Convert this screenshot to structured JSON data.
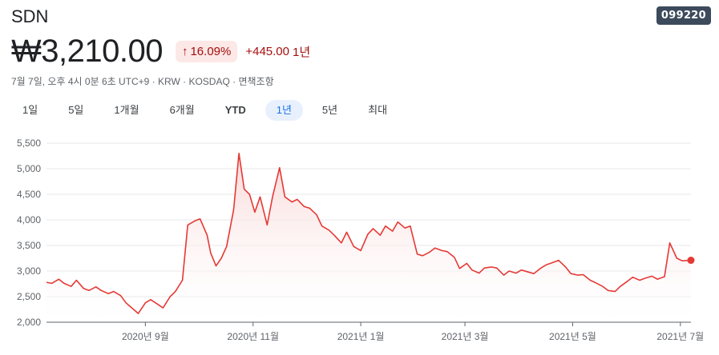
{
  "header": {
    "name": "SDN",
    "code": "099220",
    "price": "₩3,210.00",
    "change_pct": "16.09%",
    "change_arrow": "↑",
    "change_abs": "+445.00",
    "change_period": "1년",
    "meta": "7월 7일, 오후 4시 0분 6초 UTC+9 · KRW · KOSDAQ · 면책조항"
  },
  "tabs": [
    {
      "label": "1일"
    },
    {
      "label": "5일"
    },
    {
      "label": "1개월"
    },
    {
      "label": "6개월"
    },
    {
      "label": "YTD"
    },
    {
      "label": "1년",
      "active": true
    },
    {
      "label": "5년"
    },
    {
      "label": "최대"
    }
  ],
  "colors": {
    "line": "#e53935",
    "fill_top": "#f8d7d5",
    "grid": "#e8eaed",
    "badge_bg": "#fce8e6",
    "badge_text": "#a50e0e"
  },
  "chart_data": {
    "type": "area",
    "title": "",
    "xlabel": "",
    "ylabel": "",
    "ylim": [
      2000,
      5500
    ],
    "yticks": [
      "5,500",
      "5,000",
      "4,500",
      "4,000",
      "3,500",
      "3,000",
      "2,500",
      "2,000"
    ],
    "ytick_values": [
      5500,
      5000,
      4500,
      4000,
      3500,
      3000,
      2500,
      2000
    ],
    "xticks": [
      "2020년 9월",
      "2020년 11월",
      "2021년 1월",
      "2021년 3월",
      "2021년 5월",
      "2021년 7월"
    ],
    "xtick_dates": [
      "2020-09-01",
      "2020-11-01",
      "2021-01-01",
      "2021-03-01",
      "2021-05-01",
      "2021-07-01"
    ],
    "grid": true,
    "series": [
      {
        "dates": [
          "2020-07-07",
          "2020-07-10",
          "2020-07-14",
          "2020-07-17",
          "2020-07-21",
          "2020-07-24",
          "2020-07-28",
          "2020-07-31",
          "2020-08-04",
          "2020-08-07",
          "2020-08-11",
          "2020-08-14",
          "2020-08-18",
          "2020-08-21",
          "2020-08-25",
          "2020-08-28",
          "2020-09-01",
          "2020-09-04",
          "2020-09-08",
          "2020-09-11",
          "2020-09-15",
          "2020-09-18",
          "2020-09-22",
          "2020-09-25",
          "2020-09-29",
          "2020-10-02",
          "2020-10-06",
          "2020-10-08",
          "2020-10-11",
          "2020-10-14",
          "2020-10-17",
          "2020-10-21",
          "2020-10-24",
          "2020-10-27",
          "2020-10-30",
          "2020-11-02",
          "2020-11-05",
          "2020-11-09",
          "2020-11-12",
          "2020-11-16",
          "2020-11-19",
          "2020-11-23",
          "2020-11-26",
          "2020-11-30",
          "2020-12-03",
          "2020-12-07",
          "2020-12-10",
          "2020-12-14",
          "2020-12-17",
          "2020-12-21",
          "2020-12-24",
          "2020-12-28",
          "2021-01-01",
          "2021-01-05",
          "2021-01-08",
          "2021-01-12",
          "2021-01-15",
          "2021-01-19",
          "2021-01-22",
          "2021-01-26",
          "2021-01-29",
          "2021-02-02",
          "2021-02-05",
          "2021-02-09",
          "2021-02-12",
          "2021-02-16",
          "2021-02-19",
          "2021-02-23",
          "2021-02-26",
          "2021-03-02",
          "2021-03-05",
          "2021-03-09",
          "2021-03-12",
          "2021-03-16",
          "2021-03-19",
          "2021-03-23",
          "2021-03-26",
          "2021-03-30",
          "2021-04-02",
          "2021-04-06",
          "2021-04-09",
          "2021-04-13",
          "2021-04-16",
          "2021-04-20",
          "2021-04-23",
          "2021-04-27",
          "2021-04-30",
          "2021-05-04",
          "2021-05-07",
          "2021-05-11",
          "2021-05-14",
          "2021-05-18",
          "2021-05-21",
          "2021-05-25",
          "2021-05-28",
          "2021-06-01",
          "2021-06-04",
          "2021-06-08",
          "2021-06-11",
          "2021-06-15",
          "2021-06-18",
          "2021-06-22",
          "2021-06-25",
          "2021-06-29",
          "2021-07-02",
          "2021-07-07"
        ],
        "values": [
          2780,
          2760,
          2840,
          2760,
          2700,
          2820,
          2660,
          2620,
          2690,
          2620,
          2560,
          2600,
          2520,
          2380,
          2260,
          2170,
          2380,
          2440,
          2350,
          2280,
          2500,
          2600,
          2820,
          3900,
          3980,
          4020,
          3700,
          3350,
          3100,
          3250,
          3480,
          4200,
          5300,
          4600,
          4500,
          4150,
          4450,
          3900,
          4450,
          5020,
          4450,
          4350,
          4400,
          4260,
          4230,
          4100,
          3880,
          3800,
          3700,
          3550,
          3760,
          3480,
          3400,
          3720,
          3830,
          3700,
          3880,
          3780,
          3960,
          3840,
          3880,
          3330,
          3300,
          3370,
          3450,
          3400,
          3380,
          3270,
          3050,
          3150,
          3020,
          2960,
          3060,
          3080,
          3060,
          2920,
          3000,
          2960,
          3020,
          2980,
          2950,
          3060,
          3120,
          3170,
          3210,
          3080,
          2950,
          2920,
          2930,
          2820,
          2770,
          2700,
          2620,
          2600,
          2700,
          2800,
          2880,
          2820,
          2860,
          2900,
          2840,
          2890,
          3550,
          3250,
          3200,
          3210
        ]
      }
    ]
  }
}
